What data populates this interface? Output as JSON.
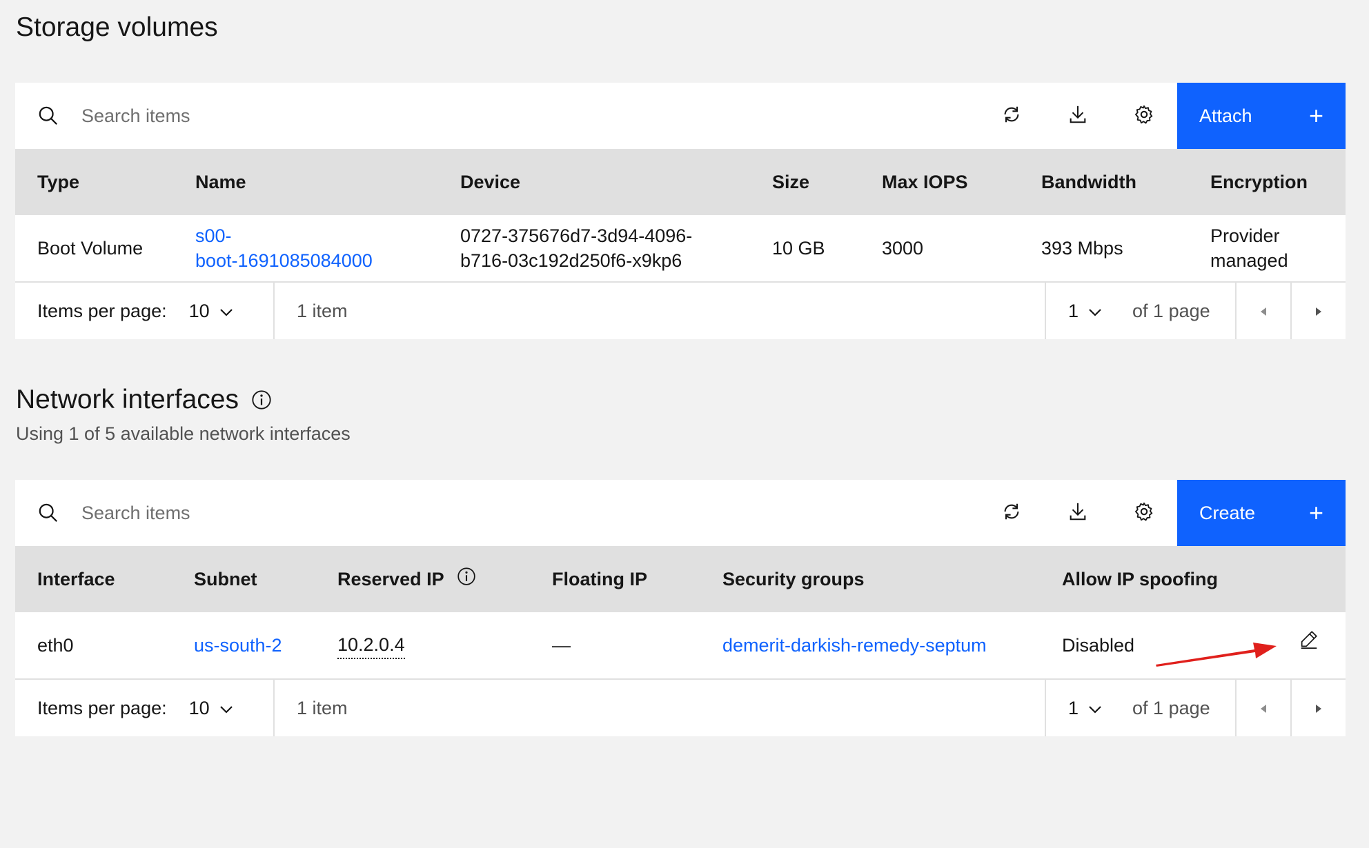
{
  "storage": {
    "title": "Storage volumes",
    "search_placeholder": "Search items",
    "action_label": "Attach",
    "columns": [
      "Type",
      "Name",
      "Device",
      "Size",
      "Max IOPS",
      "Bandwidth",
      "Encryption"
    ],
    "row": {
      "type": "Boot Volume",
      "name_line1": "s00-",
      "name_line2": "boot-1691085084000",
      "device_line1": "0727-375676d7-3d94-4096-",
      "device_line2": "b716-03c192d250f6-x9kp6",
      "size": "10 GB",
      "max_iops": "3000",
      "bandwidth": "393 Mbps",
      "encryption_line1": "Provider",
      "encryption_line2": "managed"
    },
    "pager": {
      "items_per_page_label": "Items per page:",
      "items_per_page": "10",
      "count": "1 item",
      "page": "1",
      "of_pages": "of 1 page"
    }
  },
  "network": {
    "title": "Network interfaces",
    "subtitle": "Using 1 of 5 available network interfaces",
    "search_placeholder": "Search items",
    "action_label": "Create",
    "columns": [
      "Interface",
      "Subnet",
      "Reserved IP",
      "Floating IP",
      "Security groups",
      "Allow IP spoofing"
    ],
    "row": {
      "interface": "eth0",
      "subnet": "us-south-2",
      "reserved_ip": "10.2.0.4",
      "floating_ip": "—",
      "security_groups": "demerit-darkish-remedy-septum",
      "allow_ip_spoofing": "Disabled"
    },
    "pager": {
      "items_per_page_label": "Items per page:",
      "items_per_page": "10",
      "count": "1 item",
      "page": "1",
      "of_pages": "of 1 page"
    }
  },
  "colors": {
    "primary": "#0f62fe",
    "link": "#0f62fe",
    "header_bg": "#e0e0e0",
    "page_bg": "#f2f2f2",
    "annotation_arrow": "#e0201c"
  },
  "icons": [
    "search-icon",
    "refresh-icon",
    "download-icon",
    "settings-icon",
    "add-icon",
    "chevron-down-icon",
    "caret-left-icon",
    "caret-right-icon",
    "info-icon",
    "edit-icon"
  ]
}
